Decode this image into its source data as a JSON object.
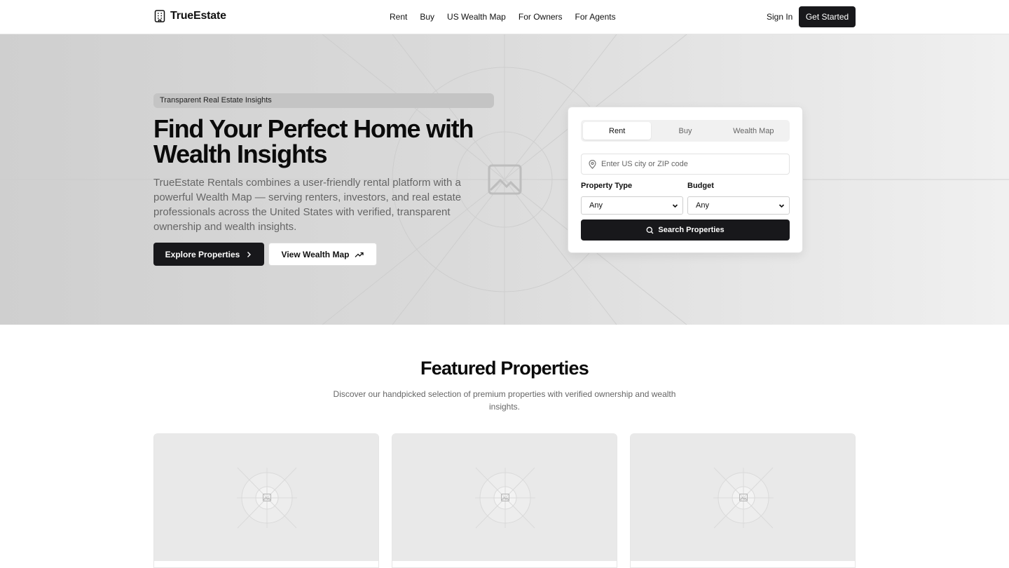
{
  "brand": {
    "name": "TrueEstate"
  },
  "nav": {
    "items": [
      "Rent",
      "Buy",
      "US Wealth Map",
      "For Owners",
      "For Agents"
    ],
    "sign_in": "Sign In",
    "get_started": "Get Started"
  },
  "hero": {
    "badge": "Transparent Real Estate Insights",
    "title": "Find Your Perfect Home with Wealth Insights",
    "description": "TrueEstate Rentals combines a user-friendly rental platform with a powerful Wealth Map — serving renters, investors, and real estate professionals across the United States with verified, transparent ownership and wealth insights.",
    "explore_button": "Explore Properties",
    "wealth_button": "View Wealth Map"
  },
  "search": {
    "tabs": [
      "Rent",
      "Buy",
      "Wealth Map"
    ],
    "active_tab": "Rent",
    "location_placeholder": "Enter US city or ZIP code",
    "property_type_label": "Property Type",
    "property_type_value": "Any",
    "budget_label": "Budget",
    "budget_value": "Any",
    "search_button": "Search Properties"
  },
  "featured": {
    "title": "Featured Properties",
    "description": "Discover our handpicked selection of premium properties with verified ownership and wealth insights."
  },
  "icons": {
    "logo": "building-icon",
    "explore": "chevron-right-icon",
    "wealth": "trending-up-icon",
    "location": "map-pin-icon",
    "search": "search-icon",
    "image_placeholder": "image-icon"
  },
  "colors": {
    "primary_button": "#18181b",
    "hero_bg": "#d9d9d9",
    "muted_text": "#666666"
  }
}
